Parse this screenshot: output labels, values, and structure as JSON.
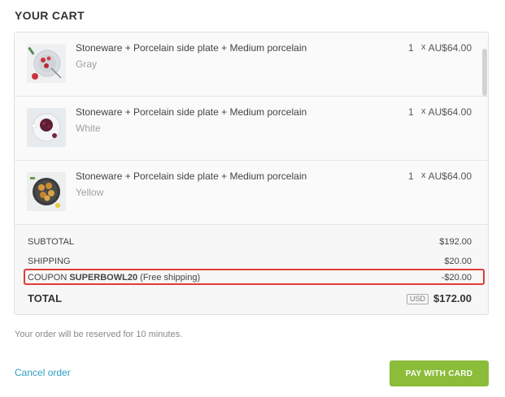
{
  "title": "YOUR CART",
  "items": [
    {
      "name": "Stoneware + Porcelain side plate + Medium porcelain",
      "variant": "Gray",
      "qty": "1",
      "times": "x",
      "price": "AU$64.00",
      "image": "plate-with-strawberries-image"
    },
    {
      "name": "Stoneware + Porcelain side plate + Medium porcelain",
      "variant": "White",
      "qty": "1",
      "times": "x",
      "price": "AU$64.00",
      "image": "plate-with-berries-image"
    },
    {
      "name": "Stoneware + Porcelain side plate + Medium porcelain",
      "variant": "Yellow",
      "qty": "1",
      "times": "x",
      "price": "AU$64.00",
      "image": "plate-with-dumplings-image"
    }
  ],
  "summary": {
    "subtotal_label": "SUBTOTAL",
    "subtotal_value": "$192.00",
    "shipping_label": "SHIPPING",
    "shipping_value": "$20.00",
    "coupon_prefix": "COUPON",
    "coupon_code": "SUPERBOWL20",
    "coupon_note": "(Free shipping)",
    "coupon_value": "-$20.00",
    "total_label": "TOTAL",
    "currency": "USD",
    "total_value": "$172.00"
  },
  "note": "Your order will be reserved for 10 minutes.",
  "cancel_label": "Cancel order",
  "pay_label": "PAY WITH CARD",
  "colors": {
    "accent_green": "#8bbd3a",
    "link_blue": "#2f9fc4",
    "highlight_red": "#e03b3b"
  }
}
